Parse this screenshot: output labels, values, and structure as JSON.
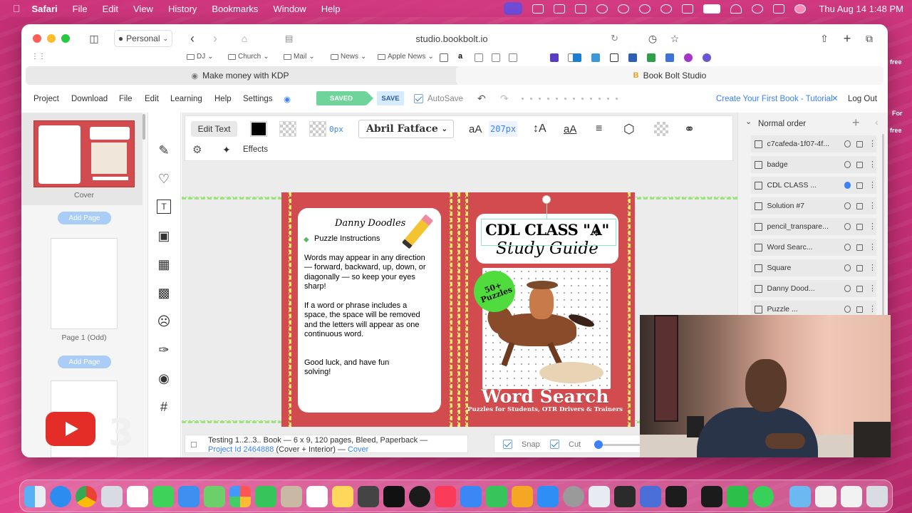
{
  "menubar": {
    "app": "Safari",
    "items": [
      "File",
      "Edit",
      "View",
      "History",
      "Bookmarks",
      "Window",
      "Help"
    ],
    "clock": "Thu Aug 14  1:48 PM"
  },
  "browser": {
    "profile": "Personal",
    "url": "studio.bookbolt.io",
    "favorites": [
      "DJ",
      "Church",
      "Mail",
      "News",
      "Apple News"
    ],
    "tabs": [
      {
        "label": "Make money with KDP"
      },
      {
        "label": "Book Bolt Studio"
      }
    ]
  },
  "appnav": {
    "items": [
      "Project",
      "Download",
      "File",
      "Edit",
      "Learning",
      "Help",
      "Settings"
    ],
    "saved": "SAVED",
    "save": "SAVE",
    "autosave": "AutoSave",
    "tutorial": "Create Your First Book - Tutorial",
    "logout": "Log Out"
  },
  "pages": {
    "cover_label": "Cover",
    "add_page": "Add Page",
    "page1_label": "Page 1 (Odd)"
  },
  "toolbar": {
    "edit_text": "Edit Text",
    "padding_value": "0px",
    "font": "Abril Fatface",
    "size_glyph": "aA",
    "font_size": "207px",
    "effects": "Effects",
    "colors": {
      "text": "#000000",
      "accent": "#3b82f6"
    }
  },
  "cover": {
    "author": "Danny Doodles",
    "instr_title": "Puzzle Instructions",
    "para1": "Words may appear in any direction — forward, backward, up, down, or diagonally — so keep your eyes sharp!",
    "para2": "If a word or phrase includes a space, the space will be removed and the letters will appear as one continuous word.",
    "para3": "Good luck, and have fun solving!",
    "title1": "CDL CLASS \"A\"",
    "title2": "Study Guide",
    "badge": "50+ Puzzles",
    "ws_title": "Word Search",
    "ws_sub": "Puzzles for Students, OTR Drivers & Trainers",
    "bg_color": "#d24c4f"
  },
  "status": {
    "name": "Testing 1..2..3.. Book",
    "details": " — 6 x 9, 120 pages, Bleed, Paperback —",
    "project_id": "Project Id 2464888",
    "scope": " (Cover + Interior) — ",
    "cover": "Cover",
    "snap": "Snap",
    "cut": "Cut"
  },
  "layers": {
    "order": "Normal order",
    "items": [
      {
        "name": "c7cafeda-1f07-4f...",
        "active": false
      },
      {
        "name": "badge",
        "active": false
      },
      {
        "name": "CDL CLASS ...",
        "active": true
      },
      {
        "name": "Solution #7",
        "active": false
      },
      {
        "name": "pencil_transpare...",
        "active": false
      },
      {
        "name": "Word Searc...",
        "active": false
      },
      {
        "name": "Square",
        "active": false
      },
      {
        "name": "Danny Dood...",
        "active": false
      },
      {
        "name": "Puzzle ...",
        "active": false
      }
    ]
  },
  "outside": {
    "free1": "free",
    "for": "For",
    "free2": "free"
  }
}
